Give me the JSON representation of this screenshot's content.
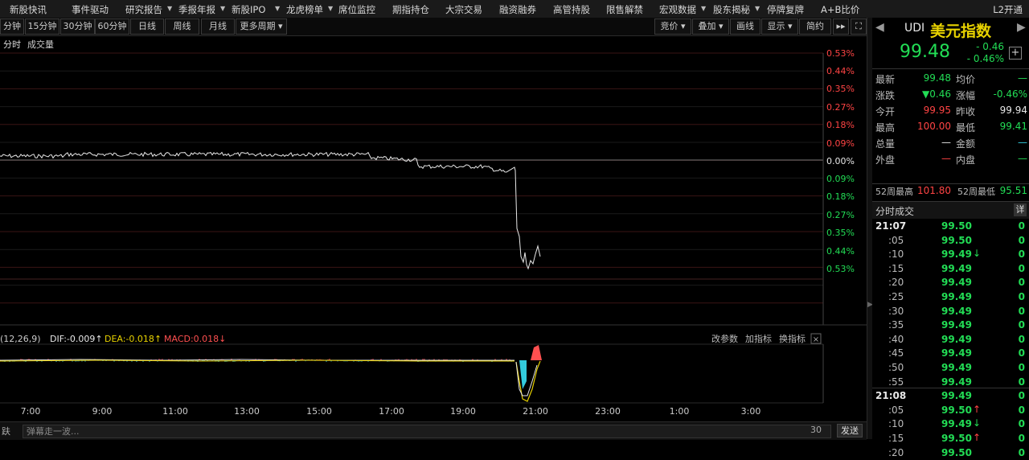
{
  "nav": {
    "items": [
      {
        "label": "新股快讯",
        "caret": false
      },
      {
        "label": "事件驱动",
        "caret": false
      },
      {
        "label": "研究报告",
        "caret": true
      },
      {
        "label": "季报年报",
        "caret": true
      },
      {
        "label": "新股IPO",
        "caret": true
      },
      {
        "label": "龙虎榜单",
        "caret": true
      },
      {
        "label": "席位监控",
        "caret": false
      },
      {
        "label": "期指持仓",
        "caret": false
      },
      {
        "label": "大宗交易",
        "caret": false
      },
      {
        "label": "融资融券",
        "caret": false
      },
      {
        "label": "高管持股",
        "caret": false
      },
      {
        "label": "限售解禁",
        "caret": false
      },
      {
        "label": "宏观数据",
        "caret": true
      },
      {
        "label": "股东揭秘",
        "caret": true
      },
      {
        "label": "停牌复牌",
        "caret": false
      },
      {
        "label": "A+B比价",
        "caret": false
      }
    ],
    "l2": "L2开通"
  },
  "periods": [
    "分钟",
    "15分钟",
    "30分钟",
    "60分钟",
    "日线",
    "周线",
    "月线",
    "更多周期"
  ],
  "tools": [
    "竞价",
    "叠加",
    "画线",
    "显示",
    "简约"
  ],
  "chart": {
    "tab_active": "分时",
    "tab_volume": "成交量",
    "pct_labels_up": [
      "0.53%",
      "0.44%",
      "0.35%",
      "0.27%",
      "0.18%",
      "0.09%"
    ],
    "pct_zero": "0.00%",
    "pct_labels_down": [
      "0.09%",
      "0.18%",
      "0.27%",
      "0.35%",
      "0.44%",
      "0.53%"
    ],
    "macd_params": "(12,26,9)",
    "dif": "DIF:-0.009",
    "dea": "DEA:-0.018",
    "macd": "MACD:0.018",
    "macd_buttons": [
      "改参数",
      "加指标",
      "换指标"
    ],
    "x_labels": [
      "7:00",
      "9:00",
      "11:00",
      "13:00",
      "15:00",
      "17:00",
      "19:00",
      "21:00",
      "23:00",
      "1:00",
      "3:00"
    ],
    "colors": {
      "up": "#ff4444",
      "down": "#22dd55",
      "neutral": "#e8e8e8",
      "dif": "#e8e8e8",
      "dea": "#e8d200",
      "macd_up": "#ff5050",
      "macd_down": "#33ccdd"
    }
  },
  "bottom": {
    "placeholder": "弹幕走一波...",
    "count": "30",
    "send": "发送",
    "left": "趺"
  },
  "quote": {
    "code": "UDI",
    "name": "美元指数",
    "price": "99.48",
    "change": "- 0.46",
    "change_pct": "- 0.46%",
    "rows": [
      [
        {
          "l": "最新",
          "v": "99.48",
          "c": "grn"
        },
        {
          "l": "均价",
          "v": "—",
          "c": "grn"
        }
      ],
      [
        {
          "l": "涨跌",
          "v": "▼0.46",
          "c": "grn"
        },
        {
          "l": "涨幅",
          "v": "-0.46%",
          "c": "grn"
        }
      ],
      [
        {
          "l": "今开",
          "v": "99.95",
          "c": "red"
        },
        {
          "l": "昨收",
          "v": "99.94",
          "c": "wht"
        }
      ],
      [
        {
          "l": "最高",
          "v": "100.00",
          "c": "red"
        },
        {
          "l": "最低",
          "v": "99.41",
          "c": "grn"
        }
      ],
      [
        {
          "l": "总量",
          "v": "—",
          "c": "wht"
        },
        {
          "l": "金额",
          "v": "—",
          "c": "cyan"
        }
      ],
      [
        {
          "l": "外盘",
          "v": "—",
          "c": "red"
        },
        {
          "l": "内盘",
          "v": "—",
          "c": "grn"
        }
      ]
    ],
    "week52_high_label": "52周最高",
    "week52_high": "101.80",
    "week52_low_label": "52周最低",
    "week52_low": "95.51"
  },
  "trades": {
    "title": "分时成交",
    "detail": "详",
    "rows": [
      {
        "t": "21:07",
        "p": "99.50",
        "a": "",
        "v": "0",
        "h": true
      },
      {
        "t": ":05",
        "p": "99.50",
        "a": "",
        "v": "0",
        "h": false
      },
      {
        "t": ":10",
        "p": "99.49",
        "a": "↓",
        "v": "0",
        "h": false
      },
      {
        "t": ":15",
        "p": "99.49",
        "a": "",
        "v": "0",
        "h": false
      },
      {
        "t": ":20",
        "p": "99.49",
        "a": "",
        "v": "0",
        "h": false
      },
      {
        "t": ":25",
        "p": "99.49",
        "a": "",
        "v": "0",
        "h": false
      },
      {
        "t": ":30",
        "p": "99.49",
        "a": "",
        "v": "0",
        "h": false
      },
      {
        "t": ":35",
        "p": "99.49",
        "a": "",
        "v": "0",
        "h": false
      },
      {
        "t": ":40",
        "p": "99.49",
        "a": "",
        "v": "0",
        "h": false
      },
      {
        "t": ":45",
        "p": "99.49",
        "a": "",
        "v": "0",
        "h": false
      },
      {
        "t": ":50",
        "p": "99.49",
        "a": "",
        "v": "0",
        "h": false
      },
      {
        "t": ":55",
        "p": "99.49",
        "a": "",
        "v": "0",
        "h": false
      },
      {
        "t": "21:08",
        "p": "99.49",
        "a": "",
        "v": "0",
        "h": true
      },
      {
        "t": ":05",
        "p": "99.50",
        "a": "↑",
        "v": "0",
        "h": false
      },
      {
        "t": ":10",
        "p": "99.49",
        "a": "↓",
        "v": "0",
        "h": false
      },
      {
        "t": ":15",
        "p": "99.50",
        "a": "↑",
        "v": "0",
        "h": false
      },
      {
        "t": ":20",
        "p": "99.50",
        "a": "",
        "v": "0",
        "h": false
      }
    ]
  }
}
